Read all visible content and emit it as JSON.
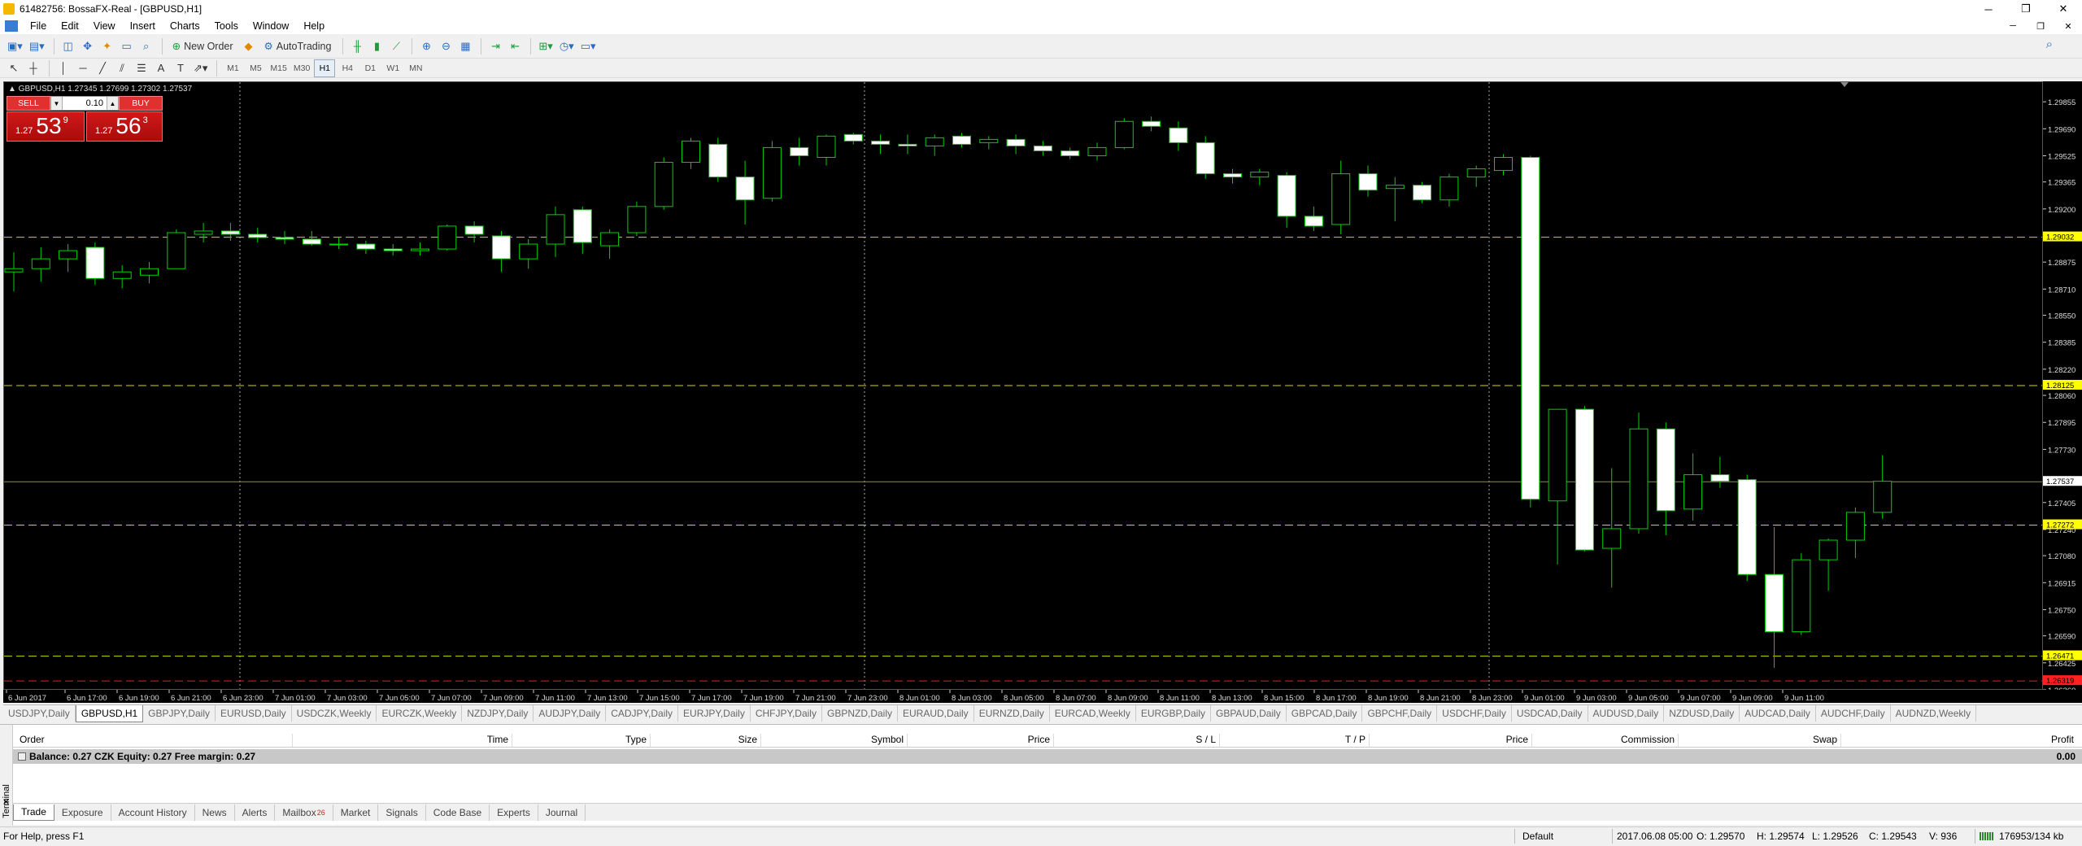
{
  "window": {
    "title": "61482756: BossaFX-Real - [GBPUSD,H1]",
    "buttons": [
      "─",
      "❐",
      "✕"
    ],
    "mdi_buttons": [
      "─",
      "❐",
      "✕"
    ]
  },
  "menu": [
    "File",
    "Edit",
    "View",
    "Insert",
    "Charts",
    "Tools",
    "Window",
    "Help"
  ],
  "toolbar": {
    "new_order": "New Order",
    "autotrading": "AutoTrading",
    "timeframes": [
      "M1",
      "M5",
      "M15",
      "M30",
      "H1",
      "H4",
      "D1",
      "W1",
      "MN"
    ],
    "active_timeframe": "H1"
  },
  "chart": {
    "info": "▲ GBPUSD,H1  1.27345 1.27699 1.27302 1.27537",
    "oneclick": {
      "sell_label": "SELL",
      "buy_label": "BUY",
      "lot": "0.10",
      "sell_prefix": "1.27",
      "sell_big": "53",
      "sell_sup": "9",
      "buy_prefix": "1.27",
      "buy_big": "56",
      "buy_sup": "3"
    },
    "price_labels": [
      "1.29855",
      "1.29690",
      "1.29525",
      "1.29365",
      "1.29200",
      "1.28875",
      "1.28710",
      "1.28550",
      "1.28385",
      "1.28220",
      "1.28060",
      "1.27895",
      "1.27730",
      "1.27405",
      "1.27240",
      "1.27080",
      "1.26915",
      "1.26750",
      "1.26590",
      "1.26425",
      "1.26260"
    ],
    "hlines": [
      {
        "price": "1.29032",
        "color": "#d4d400",
        "label_bg": "#ffff00"
      },
      {
        "price": "1.28125",
        "color": "#d4d400",
        "label_bg": "#ffff00"
      },
      {
        "price": "1.27272",
        "color": "#d4d400",
        "label_bg": "#ffff00"
      },
      {
        "price": "1.26471",
        "color": "#d4d400",
        "label_bg": "#ffff00"
      },
      {
        "price": "1.26319",
        "color": "#e02020",
        "label_bg": "#ff2020"
      }
    ],
    "bid_line": "1.27537",
    "time_labels": [
      "6 Jun 2017",
      "6 Jun 17:00",
      "6 Jun 19:00",
      "6 Jun 21:00",
      "6 Jun 23:00",
      "7 Jun 01:00",
      "7 Jun 03:00",
      "7 Jun 05:00",
      "7 Jun 07:00",
      "7 Jun 09:00",
      "7 Jun 11:00",
      "7 Jun 13:00",
      "7 Jun 15:00",
      "7 Jun 17:00",
      "7 Jun 19:00",
      "7 Jun 21:00",
      "7 Jun 23:00",
      "8 Jun 01:00",
      "8 Jun 03:00",
      "8 Jun 05:00",
      "8 Jun 07:00",
      "8 Jun 09:00",
      "8 Jun 11:00",
      "8 Jun 13:00",
      "8 Jun 15:00",
      "8 Jun 17:00",
      "8 Jun 19:00",
      "8 Jun 21:00",
      "8 Jun 23:00",
      "9 Jun 01:00",
      "9 Jun 03:00",
      "9 Jun 05:00",
      "9 Jun 07:00",
      "9 Jun 09:00",
      "9 Jun 11:00"
    ]
  },
  "chart_data": {
    "type": "candlestick",
    "symbol": "GBPUSD",
    "timeframe": "H1",
    "ylim": [
      1.2626,
      1.2998
    ],
    "candles": [
      {
        "o": 1.2882,
        "h": 1.2894,
        "l": 1.287,
        "c": 1.2884
      },
      {
        "o": 1.2884,
        "h": 1.2897,
        "l": 1.2876,
        "c": 1.289
      },
      {
        "o": 1.289,
        "h": 1.2899,
        "l": 1.2882,
        "c": 1.2895
      },
      {
        "o": 1.2897,
        "h": 1.29,
        "l": 1.2874,
        "c": 1.2878
      },
      {
        "o": 1.2878,
        "h": 1.2886,
        "l": 1.2872,
        "c": 1.2882
      },
      {
        "o": 1.288,
        "h": 1.2888,
        "l": 1.2875,
        "c": 1.2884
      },
      {
        "o": 1.2884,
        "h": 1.2908,
        "l": 1.2884,
        "c": 1.2906
      },
      {
        "o": 1.2905,
        "h": 1.2912,
        "l": 1.29,
        "c": 1.2907
      },
      {
        "o": 1.2907,
        "h": 1.2912,
        "l": 1.2901,
        "c": 1.2905
      },
      {
        "o": 1.2905,
        "h": 1.2909,
        "l": 1.29,
        "c": 1.2903
      },
      {
        "o": 1.2903,
        "h": 1.2907,
        "l": 1.2899,
        "c": 1.2902
      },
      {
        "o": 1.2902,
        "h": 1.2907,
        "l": 1.2898,
        "c": 1.2899
      },
      {
        "o": 1.2899,
        "h": 1.2903,
        "l": 1.2896,
        "c": 1.2899
      },
      {
        "o": 1.2899,
        "h": 1.2901,
        "l": 1.2893,
        "c": 1.2896
      },
      {
        "o": 1.2896,
        "h": 1.2899,
        "l": 1.2892,
        "c": 1.2895
      },
      {
        "o": 1.2895,
        "h": 1.29,
        "l": 1.2892,
        "c": 1.2896
      },
      {
        "o": 1.2896,
        "h": 1.2911,
        "l": 1.2895,
        "c": 1.291
      },
      {
        "o": 1.291,
        "h": 1.2913,
        "l": 1.29,
        "c": 1.2905
      },
      {
        "o": 1.2904,
        "h": 1.2907,
        "l": 1.2882,
        "c": 1.289
      },
      {
        "o": 1.289,
        "h": 1.2902,
        "l": 1.2884,
        "c": 1.2899
      },
      {
        "o": 1.2899,
        "h": 1.2922,
        "l": 1.2891,
        "c": 1.2917
      },
      {
        "o": 1.292,
        "h": 1.2922,
        "l": 1.2893,
        "c": 1.29
      },
      {
        "o": 1.2898,
        "h": 1.2908,
        "l": 1.289,
        "c": 1.2906
      },
      {
        "o": 1.2906,
        "h": 1.2925,
        "l": 1.2904,
        "c": 1.2922
      },
      {
        "o": 1.2922,
        "h": 1.2952,
        "l": 1.292,
        "c": 1.2949
      },
      {
        "o": 1.2949,
        "h": 1.2964,
        "l": 1.2945,
        "c": 1.2962
      },
      {
        "o": 1.296,
        "h": 1.2964,
        "l": 1.2937,
        "c": 1.294
      },
      {
        "o": 1.294,
        "h": 1.295,
        "l": 1.2911,
        "c": 1.2926
      },
      {
        "o": 1.2927,
        "h": 1.2962,
        "l": 1.2925,
        "c": 1.2958
      },
      {
        "o": 1.2958,
        "h": 1.2964,
        "l": 1.2947,
        "c": 1.2953
      },
      {
        "o": 1.2952,
        "h": 1.2966,
        "l": 1.2947,
        "c": 1.2965
      },
      {
        "o": 1.2966,
        "h": 1.2967,
        "l": 1.296,
        "c": 1.2962
      },
      {
        "o": 1.2962,
        "h": 1.2966,
        "l": 1.2954,
        "c": 1.296
      },
      {
        "o": 1.296,
        "h": 1.2966,
        "l": 1.2954,
        "c": 1.2959
      },
      {
        "o": 1.2959,
        "h": 1.2966,
        "l": 1.2953,
        "c": 1.2964
      },
      {
        "o": 1.2965,
        "h": 1.2967,
        "l": 1.2958,
        "c": 1.296
      },
      {
        "o": 1.2961,
        "h": 1.2965,
        "l": 1.2957,
        "c": 1.2963
      },
      {
        "o": 1.2963,
        "h": 1.2966,
        "l": 1.2954,
        "c": 1.2959
      },
      {
        "o": 1.2959,
        "h": 1.2962,
        "l": 1.2953,
        "c": 1.2956
      },
      {
        "o": 1.2956,
        "h": 1.2958,
        "l": 1.2951,
        "c": 1.2953
      },
      {
        "o": 1.2953,
        "h": 1.2961,
        "l": 1.295,
        "c": 1.2958
      },
      {
        "o": 1.2958,
        "h": 1.2976,
        "l": 1.2957,
        "c": 1.2974
      },
      {
        "o": 1.2974,
        "h": 1.2977,
        "l": 1.2968,
        "c": 1.2971
      },
      {
        "o": 1.297,
        "h": 1.2974,
        "l": 1.2956,
        "c": 1.2961
      },
      {
        "o": 1.2961,
        "h": 1.2965,
        "l": 1.2939,
        "c": 1.2942
      },
      {
        "o": 1.2942,
        "h": 1.2945,
        "l": 1.2936,
        "c": 1.294
      },
      {
        "o": 1.294,
        "h": 1.2945,
        "l": 1.2935,
        "c": 1.2943
      },
      {
        "o": 1.2941,
        "h": 1.2943,
        "l": 1.2909,
        "c": 1.2916
      },
      {
        "o": 1.2916,
        "h": 1.2922,
        "l": 1.2907,
        "c": 1.291
      },
      {
        "o": 1.2911,
        "h": 1.295,
        "l": 1.2905,
        "c": 1.2942
      },
      {
        "o": 1.2942,
        "h": 1.2947,
        "l": 1.2928,
        "c": 1.2932
      },
      {
        "o": 1.2933,
        "h": 1.294,
        "l": 1.2913,
        "c": 1.2935
      },
      {
        "o": 1.2935,
        "h": 1.2937,
        "l": 1.2924,
        "c": 1.2926
      },
      {
        "o": 1.2926,
        "h": 1.2942,
        "l": 1.2922,
        "c": 1.294
      },
      {
        "o": 1.294,
        "h": 1.2947,
        "l": 1.2934,
        "c": 1.2945
      },
      {
        "o": 1.2944,
        "h": 1.2954,
        "l": 1.2941,
        "c": 1.2952
      },
      {
        "o": 1.2952,
        "h": 1.2953,
        "l": 1.2738,
        "c": 1.2743
      },
      {
        "o": 1.2742,
        "h": 1.2798,
        "l": 1.2703,
        "c": 1.2798
      },
      {
        "o": 1.2798,
        "h": 1.28,
        "l": 1.2711,
        "c": 1.2712
      },
      {
        "o": 1.2713,
        "h": 1.2762,
        "l": 1.2689,
        "c": 1.2725
      },
      {
        "o": 1.2725,
        "h": 1.2796,
        "l": 1.2722,
        "c": 1.2786
      },
      {
        "o": 1.2786,
        "h": 1.279,
        "l": 1.2721,
        "c": 1.2736
      },
      {
        "o": 1.2737,
        "h": 1.2771,
        "l": 1.273,
        "c": 1.2758
      },
      {
        "o": 1.2758,
        "h": 1.2769,
        "l": 1.275,
        "c": 1.2754
      },
      {
        "o": 1.2755,
        "h": 1.2758,
        "l": 1.2693,
        "c": 1.2697
      },
      {
        "o": 1.2697,
        "h": 1.2726,
        "l": 1.264,
        "c": 1.2662
      },
      {
        "o": 1.2662,
        "h": 1.271,
        "l": 1.266,
        "c": 1.2706
      },
      {
        "o": 1.2706,
        "h": 1.2719,
        "l": 1.2687,
        "c": 1.2718
      },
      {
        "o": 1.2718,
        "h": 1.2738,
        "l": 1.2707,
        "c": 1.2735
      },
      {
        "o": 1.2735,
        "h": 1.277,
        "l": 1.2731,
        "c": 1.2754
      }
    ]
  },
  "symbol_tabs": [
    "USDJPY,Daily",
    "GBPUSD,H1",
    "GBPJPY,Daily",
    "EURUSD,Daily",
    "USDCZK,Weekly",
    "EURCZK,Weekly",
    "NZDJPY,Daily",
    "AUDJPY,Daily",
    "CADJPY,Daily",
    "EURJPY,Daily",
    "CHFJPY,Daily",
    "GBPNZD,Daily",
    "EURAUD,Daily",
    "EURNZD,Daily",
    "EURCAD,Weekly",
    "EURGBP,Daily",
    "GBPAUD,Daily",
    "GBPCAD,Daily",
    "GBPCHF,Daily",
    "USDCHF,Daily",
    "USDCAD,Daily",
    "AUDUSD,Daily",
    "NZDUSD,Daily",
    "AUDCAD,Daily",
    "AUDCHF,Daily",
    "AUDNZD,Weekly"
  ],
  "active_symbol_tab": "GBPUSD,H1",
  "terminal": {
    "side_label": "Terminal",
    "close": "✕",
    "columns": [
      "Order",
      "Time",
      "Type",
      "Size",
      "Symbol",
      "Price",
      "S / L",
      "T / P",
      "Price",
      "Commission",
      "Swap",
      "Profit"
    ],
    "balance_text": "Balance: 0.27 CZK  Equity: 0.27  Free margin: 0.27",
    "profit_total": "0.00",
    "tabs": [
      "Trade",
      "Exposure",
      "Account History",
      "News",
      "Alerts",
      "Mailbox",
      "Market",
      "Signals",
      "Code Base",
      "Experts",
      "Journal"
    ],
    "mailbox_count": "26",
    "active_tab": "Trade"
  },
  "status": {
    "help": "For Help, press F1",
    "profile": "Default",
    "datetime": "2017.06.08 05:00",
    "open": "O: 1.29570",
    "high": "H: 1.29574",
    "low": "L: 1.29526",
    "close": "C: 1.29543",
    "volume": "V: 936",
    "traffic": "176953/134 kb"
  }
}
